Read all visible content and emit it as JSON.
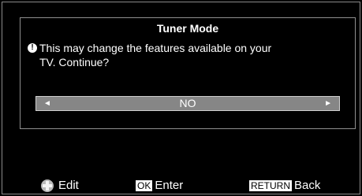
{
  "dialog": {
    "title": "Tuner Mode",
    "warning_icon": "!",
    "message_line1": "This may change the features available on your",
    "message_line2": "TV. Continue?",
    "selector": {
      "value": "NO",
      "left_arrow": "◄",
      "right_arrow": "►"
    }
  },
  "footer": {
    "edit": {
      "icon": "dpad-icon",
      "label": "Edit"
    },
    "enter": {
      "key": "OK",
      "label": "Enter"
    },
    "back": {
      "key": "RETURN",
      "label": "Back"
    }
  },
  "colors": {
    "background": "#000000",
    "dialog_border": "#8f8f8f",
    "selector_fill": "#868686",
    "text": "#ffffff"
  }
}
